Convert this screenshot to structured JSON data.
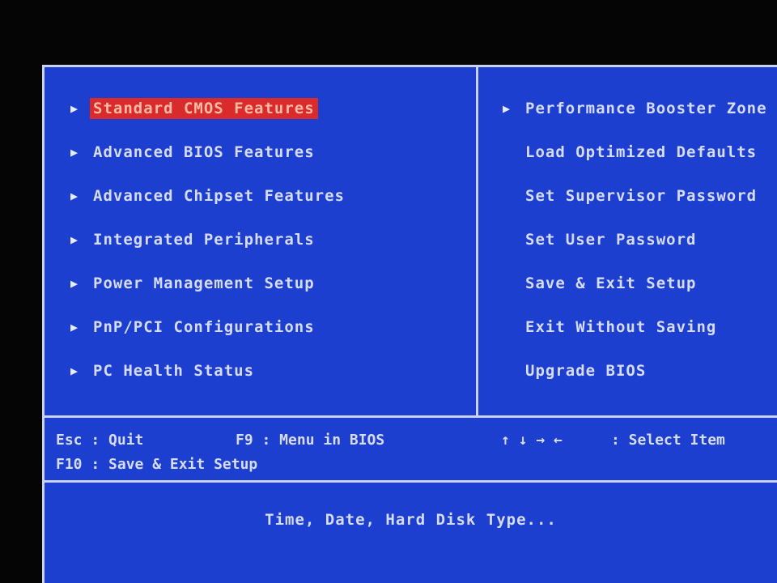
{
  "left_menu": [
    {
      "label": "Standard CMOS Features",
      "arrow": "▶",
      "selected": true
    },
    {
      "label": "Advanced BIOS Features",
      "arrow": "▶"
    },
    {
      "label": "Advanced Chipset Features",
      "arrow": "▶"
    },
    {
      "label": "Integrated Peripherals",
      "arrow": "▶"
    },
    {
      "label": "Power Management Setup",
      "arrow": "▶"
    },
    {
      "label": "PnP/PCI Configurations",
      "arrow": "▶"
    },
    {
      "label": "PC Health Status",
      "arrow": "▶"
    }
  ],
  "right_menu": [
    {
      "label": "Performance Booster Zone",
      "arrow": "▶"
    },
    {
      "label": "Load Optimized Defaults"
    },
    {
      "label": "Set Supervisor Password"
    },
    {
      "label": "Set User Password"
    },
    {
      "label": "Save & Exit Setup"
    },
    {
      "label": "Exit Without Saving"
    },
    {
      "label": "Upgrade BIOS"
    }
  ],
  "keys": {
    "esc": "Esc : Quit",
    "f9": "F9 : Menu in BIOS",
    "arrows": "↑ ↓ → ←",
    "select": ": Select Item",
    "f10": "F10 : Save & Exit Setup"
  },
  "status_text": "Time, Date, Hard Disk Type...",
  "colors": {
    "background": "#1c3fd0",
    "highlight": "#d92b2b",
    "text": "#d7dcf6",
    "border": "#c9d2f2"
  }
}
